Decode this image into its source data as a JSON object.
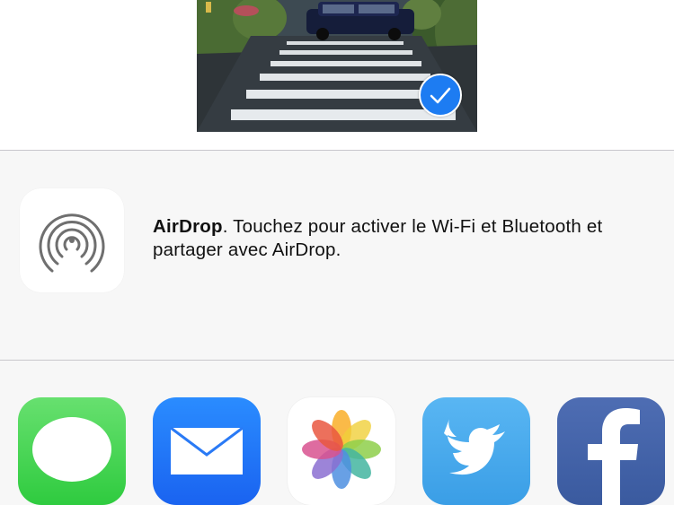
{
  "photo": {
    "selected": true,
    "check_icon": "checkmark-icon"
  },
  "airdrop": {
    "icon": "airdrop-icon",
    "title": "AirDrop",
    "message": ". Touchez pour activer le Wi-Fi et Bluetooth et partager avec AirDrop."
  },
  "apps": [
    {
      "icon": "messages-app-icon",
      "color": "#4cd964"
    },
    {
      "icon": "mail-app-icon",
      "color": "#1e74f5"
    },
    {
      "icon": "photos-app-icon",
      "color": "#ffffff"
    },
    {
      "icon": "twitter-app-icon",
      "color": "#4aa8ec"
    },
    {
      "icon": "facebook-app-icon",
      "color": "#4462a8"
    }
  ]
}
